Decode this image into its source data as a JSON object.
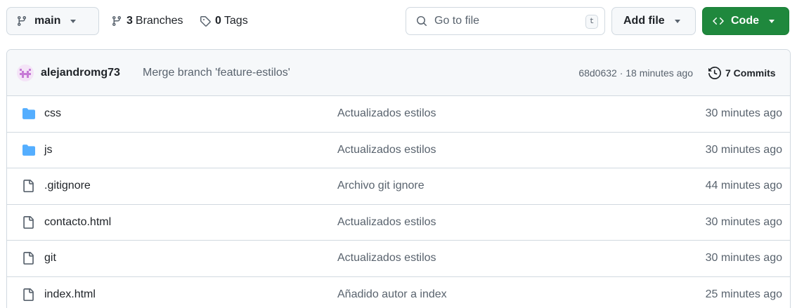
{
  "toolbar": {
    "branch_name": "main",
    "branches_count": "3",
    "branches_word": "Branches",
    "tags_count": "0",
    "tags_word": "Tags",
    "search_placeholder": "Go to file",
    "search_shortcut": "t",
    "add_file_label": "Add file",
    "code_label": "Code"
  },
  "latest_commit": {
    "author": "alejandromg73",
    "message": "Merge branch 'feature-estilos'",
    "meta": "68d0632 · 18 minutes ago",
    "commits_label": "7 Commits"
  },
  "files": [
    {
      "type": "folder",
      "name": "css",
      "message": "Actualizados estilos",
      "age": "30 minutes ago"
    },
    {
      "type": "folder",
      "name": "js",
      "message": "Actualizados estilos",
      "age": "30 minutes ago"
    },
    {
      "type": "file",
      "name": ".gitignore",
      "message": "Archivo git ignore",
      "age": "44 minutes ago"
    },
    {
      "type": "file",
      "name": "contacto.html",
      "message": "Actualizados estilos",
      "age": "30 minutes ago"
    },
    {
      "type": "file",
      "name": "git",
      "message": "Actualizados estilos",
      "age": "30 minutes ago"
    },
    {
      "type": "file",
      "name": "index.html",
      "message": "Añadido autor a index",
      "age": "25 minutes ago"
    }
  ],
  "colors": {
    "accent_green": "#1f883d",
    "folder_blue": "#54aeff",
    "muted_text": "#59636e",
    "border": "#d1d9e0"
  },
  "icons": {
    "branch": "git-branch-icon",
    "tag": "tag-icon",
    "search": "search-icon",
    "code": "code-icon",
    "history": "history-icon",
    "folder": "folder-icon",
    "file": "file-icon"
  }
}
